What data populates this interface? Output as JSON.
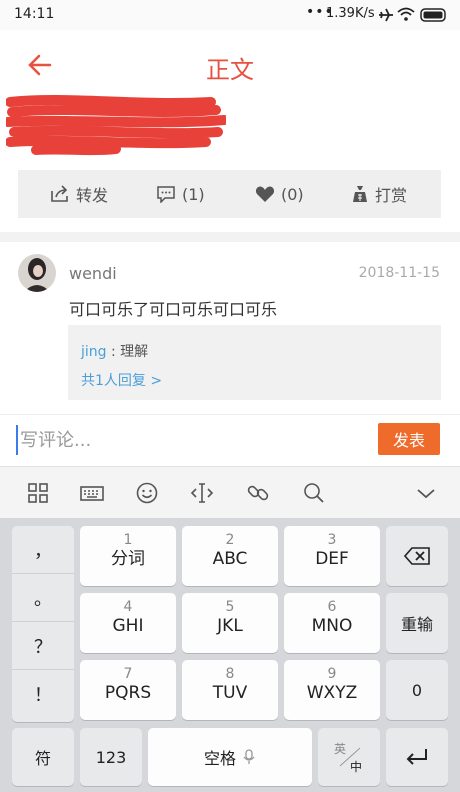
{
  "status_bar": {
    "time": "14:11",
    "network_speed": "1.39K/s",
    "dots": "•••"
  },
  "header": {
    "title": "正文"
  },
  "actions": {
    "forward_label": "转发",
    "comments_count": "(1)",
    "likes_count": "(0)",
    "reward_label": "打赏"
  },
  "comment": {
    "username": "wendi",
    "date": "2018-11-15",
    "text": "可口可乐了可口可乐可口可乐",
    "reply": {
      "user": "jing",
      "separator": " : ",
      "text": "理解",
      "more": "共1人回复 >"
    }
  },
  "input": {
    "placeholder": "写评论...",
    "submit_label": "发表"
  },
  "keyboard": {
    "punctuation": [
      "，",
      "。",
      "？",
      "！"
    ],
    "keys": [
      {
        "num": "1",
        "label": "分词"
      },
      {
        "num": "2",
        "label": "ABC"
      },
      {
        "num": "3",
        "label": "DEF"
      },
      {
        "num": "4",
        "label": "GHI"
      },
      {
        "num": "5",
        "label": "JKL"
      },
      {
        "num": "6",
        "label": "MNO"
      },
      {
        "num": "7",
        "label": "PQRS"
      },
      {
        "num": "8",
        "label": "TUV"
      },
      {
        "num": "9",
        "label": "WXYZ"
      }
    ],
    "retype_label": "重输",
    "zero_label": "0",
    "symbol_label": "符",
    "numbers_label": "123",
    "space_label": "空格",
    "lang_en": "英",
    "lang_zh": "中"
  },
  "colors": {
    "accent": "#e8513f",
    "submit": "#ef6b2b",
    "link": "#4a9fd8"
  }
}
